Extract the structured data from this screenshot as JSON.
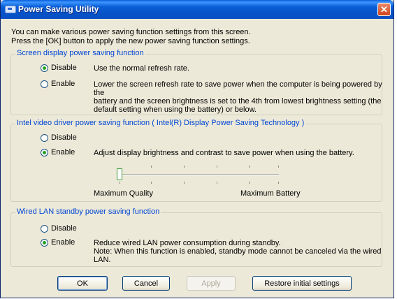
{
  "window": {
    "title": "Power Saving Utility",
    "close_label": "✕"
  },
  "intro": [
    "You can make various power saving function settings from this screen.",
    "Press the [OK] button to apply the new power saving function settings."
  ],
  "screen_group": {
    "legend": "Screen display power saving function",
    "options": [
      {
        "label": "Disable",
        "checked": true
      },
      {
        "label": "Enable",
        "checked": false
      }
    ],
    "disable_desc": "Use the normal refresh rate.",
    "enable_desc": [
      "Lower the screen refresh rate to save power when the computer is being powered by the",
      "battery and the screen brightness is set to the 4th from lowest brightness setting (the",
      "default setting when using the battery) or below."
    ]
  },
  "intel_group": {
    "legend": "Intel video driver power saving function ( Intel(R) Display Power Saving Technology )",
    "options": [
      {
        "label": "Disable",
        "checked": false
      },
      {
        "label": "Enable",
        "checked": true
      }
    ],
    "enable_desc": "Adjust display brightness and contrast to save power when using the battery.",
    "slider": {
      "min_label": "Maximum Quality",
      "max_label": "Maximum Battery",
      "level": 0
    }
  },
  "lan_group": {
    "legend": "Wired LAN standby power saving function",
    "options": [
      {
        "label": "Disable",
        "checked": false
      },
      {
        "label": "Enable",
        "checked": true
      }
    ],
    "enable_desc": [
      "Reduce wired LAN power consumption during standby.",
      "Note: When this function is enabled, standby mode cannot be canceled via the wired LAN."
    ]
  },
  "buttons": {
    "ok": "OK",
    "cancel": "Cancel",
    "apply": "Apply",
    "restore": "Restore initial settings"
  },
  "colors": {
    "titlebar": "#0a5fd8",
    "legend": "#0046d5",
    "dialog_bg": "#ece9d8"
  }
}
